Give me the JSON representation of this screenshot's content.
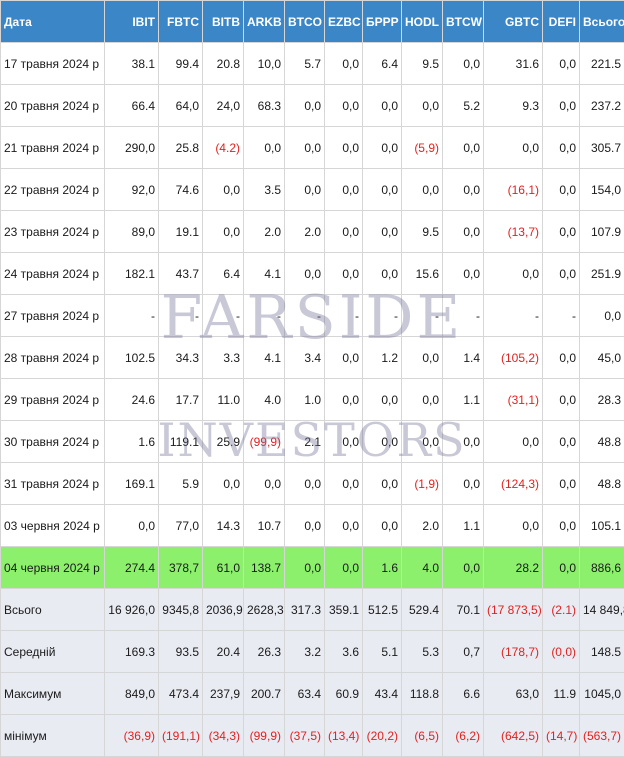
{
  "columns": [
    "Дата",
    "IBIT",
    "FBTC",
    "BITB",
    "ARKB",
    "BTCO",
    "EZBC",
    "БРРР",
    "HODL",
    "BTCW",
    "GBTC",
    "DEFI",
    "Всього"
  ],
  "rows": [
    {
      "date": "17 травня 2024 р",
      "values": [
        "38.1",
        "99.4",
        "20.8",
        "10,0",
        "5.7",
        "0,0",
        "6.4",
        "9.5",
        "0,0",
        "31.6",
        "0,0",
        "221.5"
      ]
    },
    {
      "date": "20 травня 2024 р",
      "values": [
        "66.4",
        "64,0",
        "24,0",
        "68.3",
        "0,0",
        "0,0",
        "0,0",
        "0,0",
        "5.2",
        "9.3",
        "0,0",
        "237.2"
      ]
    },
    {
      "date": "21 травня 2024 р",
      "values": [
        "290,0",
        "25.8",
        "(4.2)",
        "0,0",
        "0,0",
        "0,0",
        "0,0",
        "(5,9)",
        "0,0",
        "0,0",
        "0,0",
        "305.7"
      ]
    },
    {
      "date": "22 травня 2024 р",
      "values": [
        "92,0",
        "74.6",
        "0,0",
        "3.5",
        "0,0",
        "0,0",
        "0,0",
        "0,0",
        "0,0",
        "(16,1)",
        "0,0",
        "154,0"
      ]
    },
    {
      "date": "23 травня 2024 р",
      "values": [
        "89,0",
        "19.1",
        "0,0",
        "2.0",
        "2.0",
        "0,0",
        "0,0",
        "9.5",
        "0,0",
        "(13,7)",
        "0,0",
        "107.9"
      ]
    },
    {
      "date": "24 травня 2024 р",
      "values": [
        "182.1",
        "43.7",
        "6.4",
        "4.1",
        "0,0",
        "0,0",
        "0,0",
        "15.6",
        "0,0",
        "0,0",
        "0,0",
        "251.9"
      ]
    },
    {
      "date": "27 травня 2024 р",
      "values": [
        "-",
        "-",
        "-",
        "-",
        "-",
        "-",
        "-",
        "-",
        "-",
        "-",
        "-",
        "0,0"
      ]
    },
    {
      "date": "28 травня 2024 р",
      "values": [
        "102.5",
        "34.3",
        "3.3",
        "4.1",
        "3.4",
        "0,0",
        "1.2",
        "0,0",
        "1.4",
        "(105,2)",
        "0,0",
        "45,0"
      ]
    },
    {
      "date": "29 травня 2024 р",
      "values": [
        "24.6",
        "17.7",
        "11.0",
        "4.0",
        "1.0",
        "0,0",
        "0,0",
        "0,0",
        "1.1",
        "(31,1)",
        "0,0",
        "28.3"
      ]
    },
    {
      "date": "30 травня 2024 р",
      "values": [
        "1.6",
        "119.1",
        "25.9",
        "(99,9)",
        "2.1",
        "0,0",
        "0,0",
        "0,0",
        "0,0",
        "0,0",
        "0,0",
        "48.8"
      ]
    },
    {
      "date": "31 травня 2024 р",
      "values": [
        "169.1",
        "5.9",
        "0,0",
        "0,0",
        "0,0",
        "0,0",
        "0,0",
        "(1,9)",
        "0,0",
        "(124,3)",
        "0,0",
        "48.8"
      ]
    },
    {
      "date": "03 червня 2024 р",
      "values": [
        "0,0",
        "77,0",
        "14.3",
        "10.7",
        "0,0",
        "0,0",
        "0,0",
        "2.0",
        "1.1",
        "0,0",
        "0,0",
        "105.1"
      ]
    },
    {
      "date": "04 червня 2024 р",
      "values": [
        "274.4",
        "378,7",
        "61,0",
        "138.7",
        "0,0",
        "0,0",
        "1.6",
        "4.0",
        "0,0",
        "28.2",
        "0,0",
        "886,6"
      ]
    },
    {
      "date": "Всього",
      "values": [
        "16 926,0",
        "9345,8",
        "2036,9",
        "2628,3",
        "317.3",
        "359.1",
        "512.5",
        "529.4",
        "70.1",
        "(17 873,5)",
        "(2.1)",
        "14 849,8"
      ]
    },
    {
      "date": "Середній",
      "values": [
        "169.3",
        "93.5",
        "20.4",
        "26.3",
        "3.2",
        "3.6",
        "5.1",
        "5.3",
        "0,7",
        "(178,7)",
        "(0,0)",
        "148.5"
      ]
    },
    {
      "date": "Максимум",
      "values": [
        "849,0",
        "473.4",
        "237,9",
        "200.7",
        "63.4",
        "60.9",
        "43.4",
        "118.8",
        "6.6",
        "63,0",
        "11.9",
        "1045,0"
      ]
    },
    {
      "date": "мінімум",
      "values": [
        "(36,9)",
        "(191,1)",
        "(34,3)",
        "(99,9)",
        "(37,5)",
        "(13,4)",
        "(20,2)",
        "(6,5)",
        "(6,2)",
        "(642,5)",
        "(14,7)",
        "(563,7)"
      ]
    }
  ],
  "watermark": {
    "line1": "FARSIDE",
    "line2": "INVESTORS"
  },
  "colors": {
    "header": "#3b86c6",
    "highlight": "#8cf06c",
    "summary": "#e9ebf3",
    "negative": "#e0221f"
  }
}
